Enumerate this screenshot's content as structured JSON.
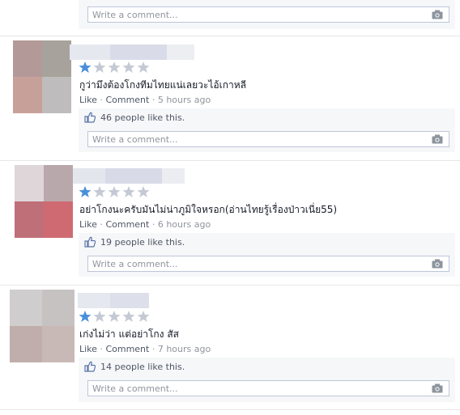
{
  "placeholder": "Write a comment...",
  "icons": {
    "camera": "camera-icon",
    "like": "thumbs-up-icon",
    "star": "star-icon"
  },
  "colors": {
    "star_filled": "#4a90d9",
    "star_empty": "#c4c9d3",
    "reply_bg": "#f6f7f9",
    "link": "#3b5998"
  },
  "comments": [
    {
      "rating": 1,
      "text": "กูว่ามึงต้องโกงทีมไทยแน่เลยวะไอ้เกาหลี",
      "like_label": "Like",
      "comment_label": "Comment",
      "time": "5 hours ago",
      "likes": "46 people like this."
    },
    {
      "rating": 1,
      "text": "อย่าโกงนะครับมันไม่น่าภูมิใจหรอก(อ่านไทยรู้เรื่องป่าวเนี่ย55)",
      "like_label": "Like",
      "comment_label": "Comment",
      "time": "6 hours ago",
      "likes": "19 people like this."
    },
    {
      "rating": 1,
      "text": "เก่งไม่ว่า แต่อย่าโกง สัส",
      "like_label": "Like",
      "comment_label": "Comment",
      "time": "7 hours ago",
      "likes": "14 people like this."
    }
  ]
}
